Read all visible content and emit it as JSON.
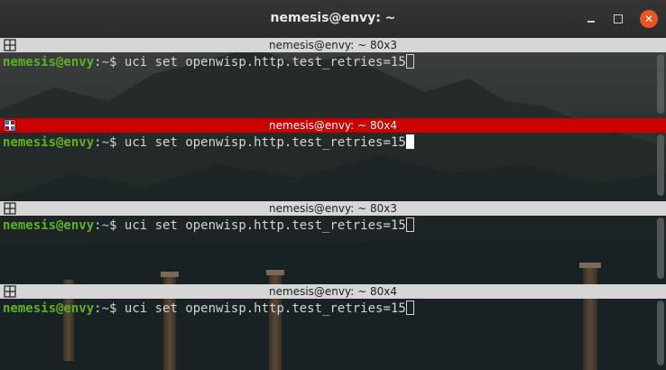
{
  "window": {
    "title": "nemesis@envy: ~",
    "controls": {
      "minimize": "minimize-icon",
      "maximize": "maximize-icon",
      "close": "close-icon"
    },
    "accent_close": "#e95420"
  },
  "panes": [
    {
      "title": "nemesis@envy: ~ 80x3",
      "active": false,
      "user": "nemesis@envy",
      "sep": ":",
      "path": "~",
      "prompt": "$ ",
      "command": "uci set openwisp.http.test_retries=15"
    },
    {
      "title": "nemesis@envy: ~ 80x4",
      "active": true,
      "user": "nemesis@envy",
      "sep": ":",
      "path": "~",
      "prompt": "$ ",
      "command": "uci set openwisp.http.test_retries=15"
    },
    {
      "title": "nemesis@envy: ~ 80x3",
      "active": false,
      "user": "nemesis@envy",
      "sep": ":",
      "path": "~",
      "prompt": "$ ",
      "command": "uci set openwisp.http.test_retries=15"
    },
    {
      "title": "nemesis@envy: ~ 80x4",
      "active": false,
      "user": "nemesis@envy",
      "sep": ":",
      "path": "~",
      "prompt": "$ ",
      "command": "uci set openwisp.http.test_retries=15"
    }
  ],
  "colors": {
    "active_title": "#cc0000",
    "inactive_title": "#d6d6d6",
    "prompt_user": "#5fb122",
    "prompt_path": "#8aa5c6"
  }
}
